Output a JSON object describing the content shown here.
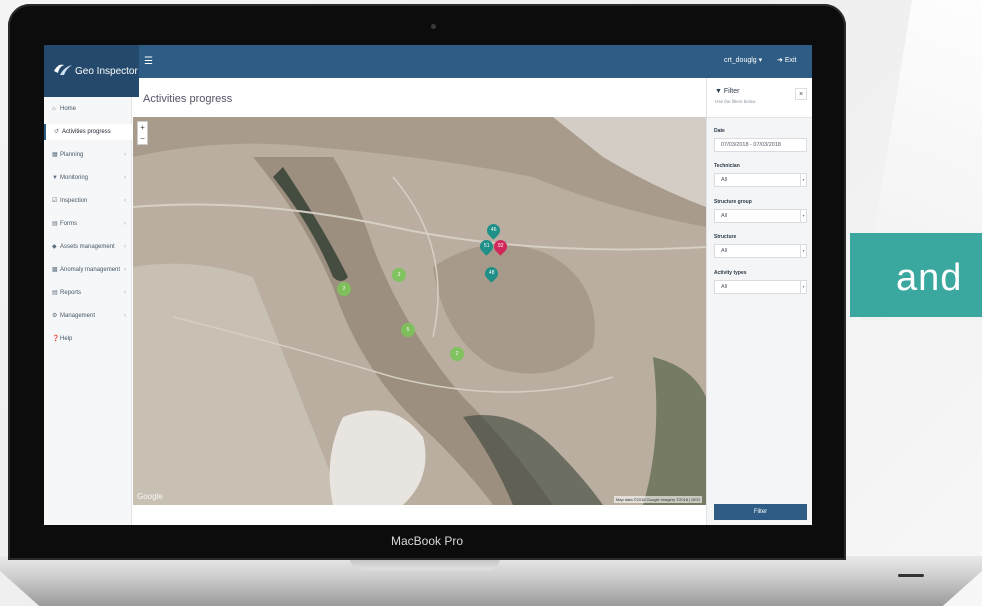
{
  "banner": {
    "text": "and"
  },
  "laptop": {
    "brand": "MacBook Pro"
  },
  "app": {
    "logo_text": "Geo Inspector",
    "menu_icon": "hamburger-icon",
    "user": "crt_douglg ▾",
    "exit_label": "Exit"
  },
  "sidebar": {
    "items": [
      {
        "label": "Home",
        "icon": "home-icon",
        "chevron": ""
      },
      {
        "label": "Activities progress",
        "icon": "history-icon",
        "chevron": ""
      },
      {
        "label": "Planning",
        "icon": "calendar-icon",
        "chevron": "‹"
      },
      {
        "label": "Monitoring",
        "icon": "monitor-icon",
        "chevron": "‹"
      },
      {
        "label": "Inspection",
        "icon": "check-icon",
        "chevron": "‹"
      },
      {
        "label": "Forms",
        "icon": "forms-icon",
        "chevron": "‹"
      },
      {
        "label": "Assets management",
        "icon": "tag-icon",
        "chevron": "‹"
      },
      {
        "label": "Anomaly management",
        "icon": "warning-icon",
        "chevron": "‹"
      },
      {
        "label": "Reports",
        "icon": "report-icon",
        "chevron": "‹"
      },
      {
        "label": "Management",
        "icon": "cogs-icon",
        "chevron": "‹"
      },
      {
        "label": "Help",
        "icon": "help-icon",
        "chevron": ""
      }
    ]
  },
  "main": {
    "title": "Activities progress"
  },
  "map": {
    "zoom_in": "+",
    "zoom_out": "−",
    "google": "Google",
    "attribution": "Map data ©2018 Google Imagery ©2018 | DEG",
    "markers": [
      {
        "label": "46",
        "color": "teal"
      },
      {
        "label": "51",
        "color": "teal"
      },
      {
        "label": "92",
        "color": "red"
      },
      {
        "label": "48",
        "color": "teal"
      },
      {
        "label": "2",
        "color": "green"
      },
      {
        "label": "3",
        "color": "green"
      },
      {
        "label": "5",
        "color": "green"
      },
      {
        "label": "2",
        "color": "green"
      }
    ]
  },
  "filter": {
    "title": "Filter",
    "subtitle": "Use the filters below",
    "close": "×",
    "date_label": "Date",
    "date_value": "07/03/2018 - 07/03/2018",
    "technician_label": "Technician",
    "technician_value": "All",
    "structure_group_label": "Structure group",
    "structure_group_value": "All",
    "structure_label": "Structure",
    "structure_value": "All",
    "activity_types_label": "Activity types",
    "activity_types_value": "All",
    "button": "Filter"
  },
  "colors": {
    "header": "#2e5c84",
    "logo_bg": "#24496c",
    "banner": "#3aa89f",
    "marker_teal": "#1f8f88",
    "marker_red": "#d0285a",
    "marker_green": "#7cc45a"
  }
}
